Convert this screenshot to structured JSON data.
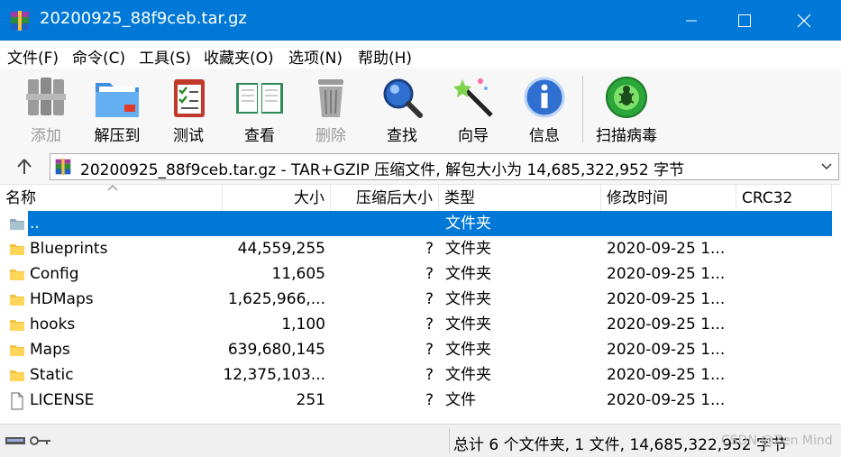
{
  "window": {
    "title": "20200925_88f9ceb.tar.gz",
    "icon": "winrar-archive-icon"
  },
  "menu": [
    "文件(F)",
    "命令(C)",
    "工具(S)",
    "收藏夹(O)",
    "选项(N)",
    "帮助(H)"
  ],
  "toolbar": [
    {
      "label": "添加",
      "icon": "add-books-icon",
      "enabled": false
    },
    {
      "label": "解压到",
      "icon": "extract-folder-icon",
      "enabled": true
    },
    {
      "label": "测试",
      "icon": "test-checklist-icon",
      "enabled": true
    },
    {
      "label": "查看",
      "icon": "view-book-icon",
      "enabled": true
    },
    {
      "label": "删除",
      "icon": "delete-trash-icon",
      "enabled": false
    },
    {
      "label": "查找",
      "icon": "find-magnifier-icon",
      "enabled": true
    },
    {
      "label": "向导",
      "icon": "wizard-wand-icon",
      "enabled": true
    },
    {
      "label": "信息",
      "icon": "info-icon",
      "enabled": true
    },
    {
      "label": "扫描病毒",
      "icon": "scan-virus-icon",
      "enabled": true
    }
  ],
  "address": {
    "text": "20200925_88f9ceb.tar.gz - TAR+GZIP 压缩文件, 解包大小为 14,685,322,952 字节"
  },
  "columns": [
    "名称",
    "大小",
    "压缩后大小",
    "类型",
    "修改时间",
    "CRC32"
  ],
  "rows": [
    {
      "name": "..",
      "size": "",
      "packed": "",
      "type": "文件夹",
      "modified": "",
      "crc": "",
      "icon": "parent-folder-icon",
      "selected": true
    },
    {
      "name": "Blueprints",
      "size": "44,559,255",
      "packed": "?",
      "type": "文件夹",
      "modified": "2020-09-25 1...",
      "crc": "",
      "icon": "folder-icon",
      "selected": false
    },
    {
      "name": "Config",
      "size": "11,605",
      "packed": "?",
      "type": "文件夹",
      "modified": "2020-09-25 1...",
      "crc": "",
      "icon": "folder-icon",
      "selected": false
    },
    {
      "name": "HDMaps",
      "size": "1,625,966,...",
      "packed": "?",
      "type": "文件夹",
      "modified": "2020-09-25 1...",
      "crc": "",
      "icon": "folder-icon",
      "selected": false
    },
    {
      "name": "hooks",
      "size": "1,100",
      "packed": "?",
      "type": "文件夹",
      "modified": "2020-09-25 1...",
      "crc": "",
      "icon": "folder-icon",
      "selected": false
    },
    {
      "name": "Maps",
      "size": "639,680,145",
      "packed": "?",
      "type": "文件夹",
      "modified": "2020-09-25 1...",
      "crc": "",
      "icon": "folder-icon",
      "selected": false
    },
    {
      "name": "Static",
      "size": "12,375,103...",
      "packed": "?",
      "type": "文件夹",
      "modified": "2020-09-25 1...",
      "crc": "",
      "icon": "folder-icon",
      "selected": false
    },
    {
      "name": "LICENSE",
      "size": "251",
      "packed": "?",
      "type": "文件",
      "modified": "2020-09-25 1...",
      "crc": "",
      "icon": "file-icon",
      "selected": false
    }
  ],
  "status": {
    "text": "总计 6 个文件夹, 1 文件, 14,685,322,952 字节",
    "watermark": "CSDN @Zen Mind"
  },
  "colors": {
    "accent": "#0078d7",
    "folder": "#f5c542"
  }
}
